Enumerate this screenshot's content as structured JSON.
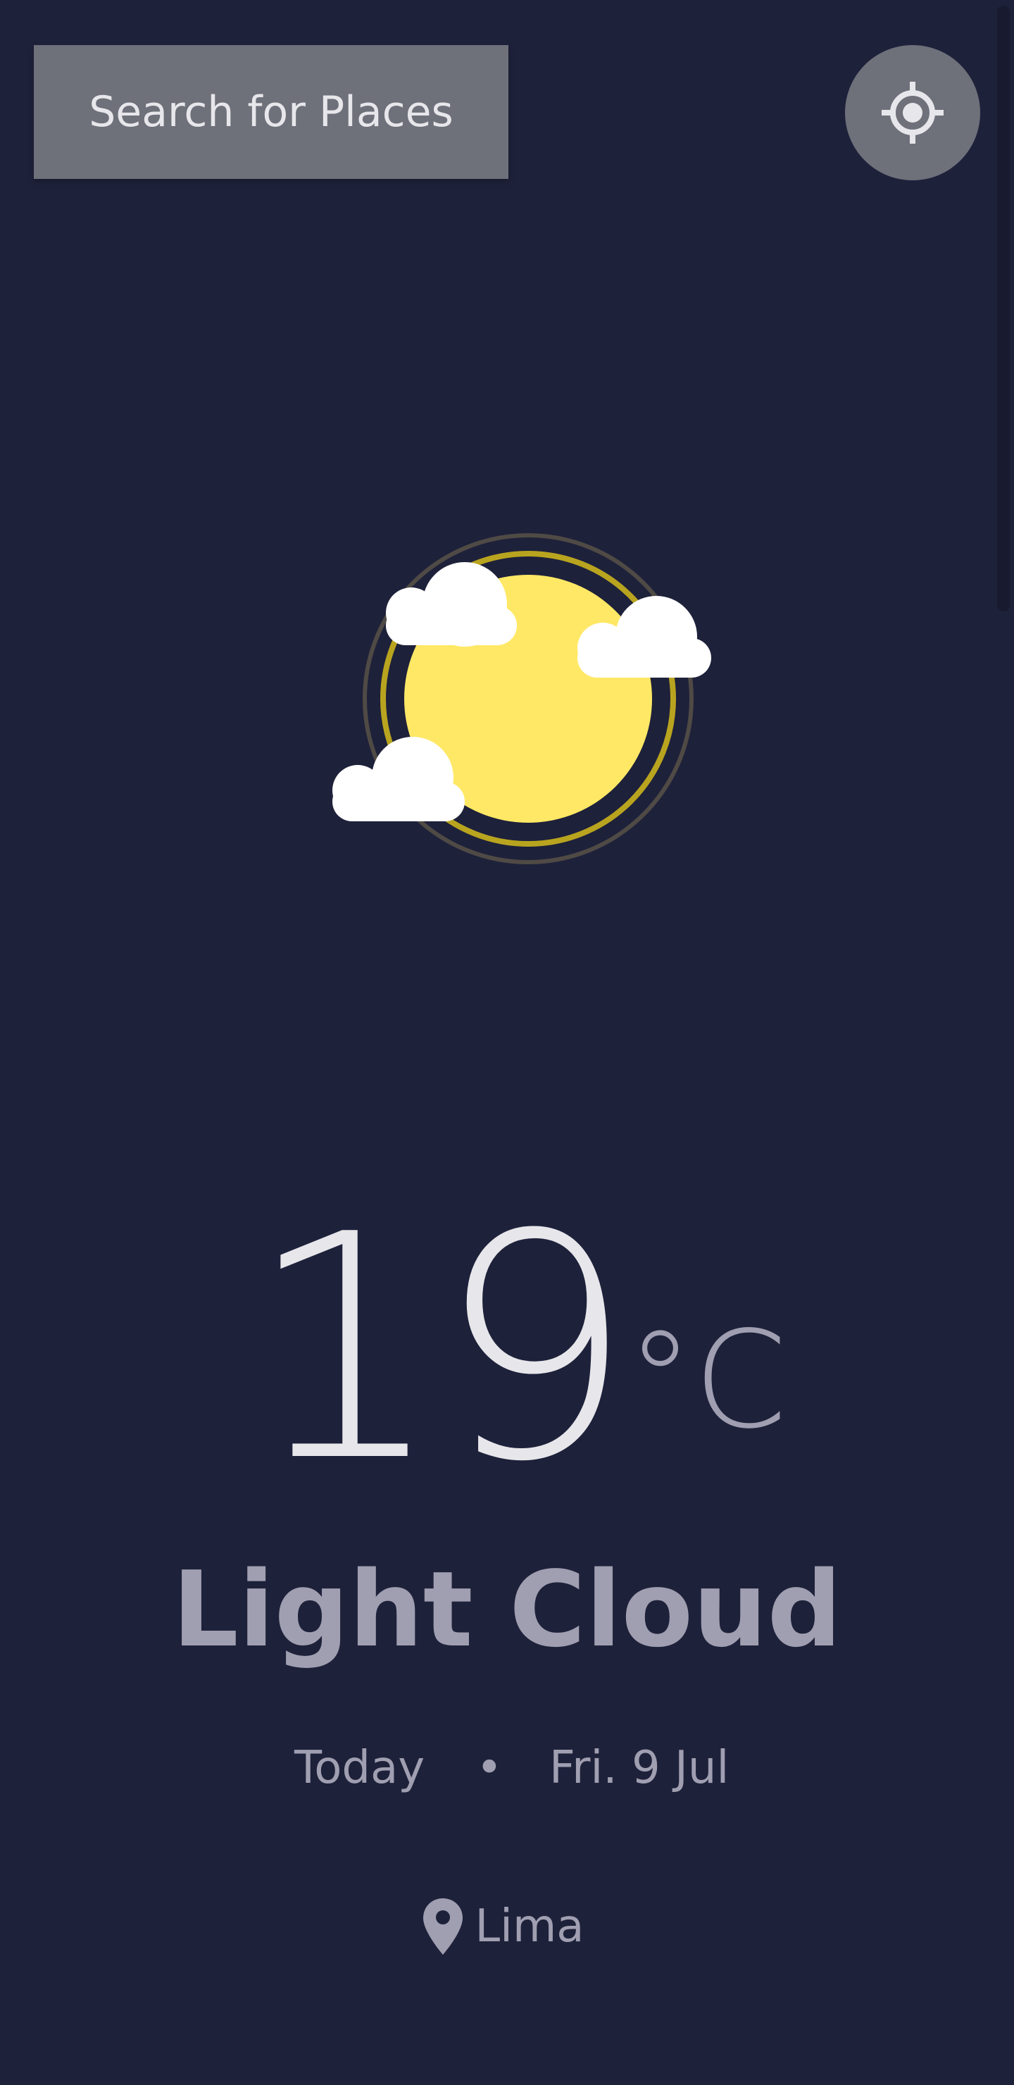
{
  "header": {
    "search_label": "Search for Places",
    "locate_icon": "crosshair-icon"
  },
  "current": {
    "icon": "light-cloud-sun-icon",
    "temperature": "19",
    "unit": "°C",
    "condition": "Light Cloud"
  },
  "date": {
    "today_label": "Today",
    "separator": "•",
    "value": "Fri. 9 Jul"
  },
  "location": {
    "icon": "map-pin-icon",
    "name": "Lima"
  },
  "colors": {
    "background": "#1e213a",
    "button": "#6e707a",
    "primary_text": "#e7e7eb",
    "secondary_text": "#a09fb1",
    "sun": "#ffe865"
  }
}
